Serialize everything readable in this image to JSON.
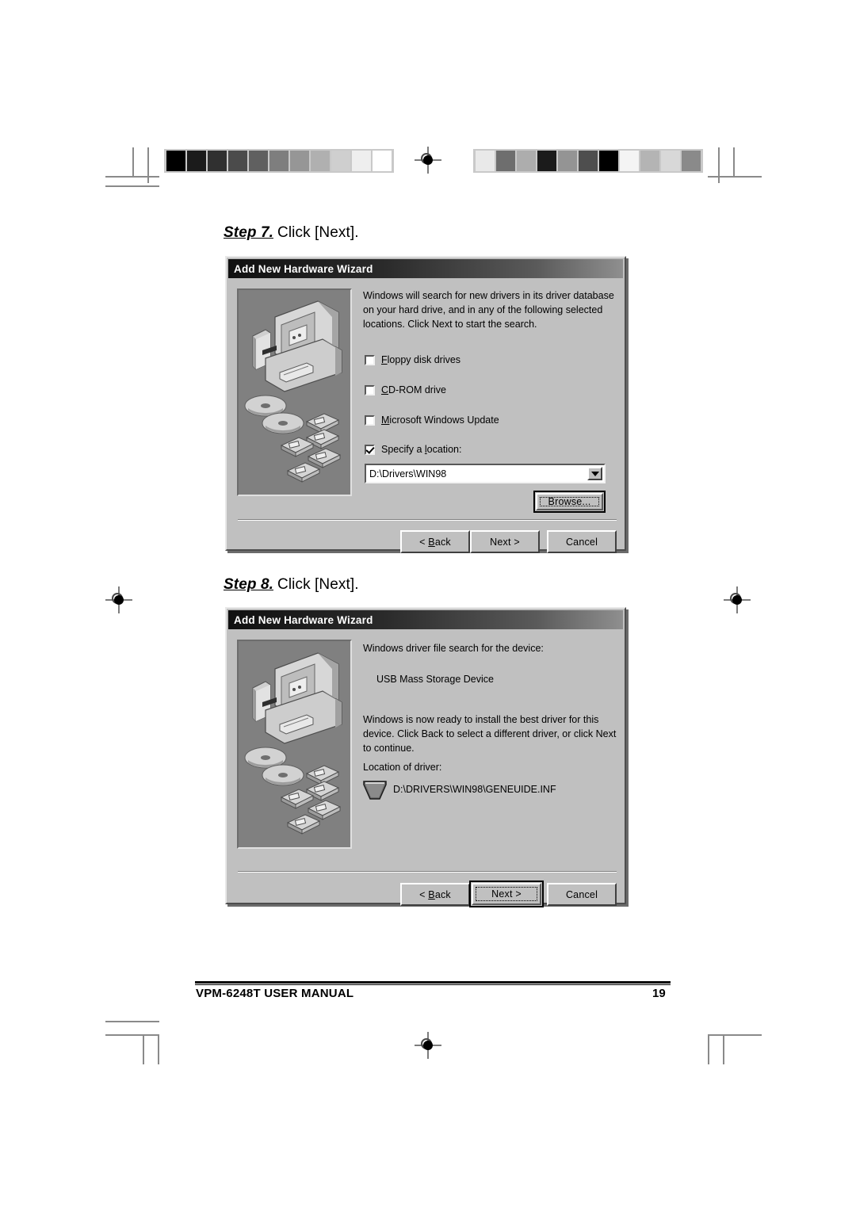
{
  "page": {
    "footer_title": "VPM-6248T USER MANUAL",
    "footer_page_number": "19"
  },
  "steps": [
    {
      "label": "Step 7.",
      "text": "Click [Next]."
    },
    {
      "label": "Step 8.",
      "text": "Click [Next]."
    }
  ],
  "dialog1": {
    "title": "Add New Hardware Wizard",
    "body_text": "Windows will search for new drivers in its driver database on your hard drive, and in any of the following selected locations. Click Next to start the search.",
    "checkboxes": [
      {
        "label": "Floppy disk drives",
        "accel": "F",
        "checked": false
      },
      {
        "label": "CD-ROM drive",
        "accel": "C",
        "checked": false
      },
      {
        "label": "Microsoft Windows Update",
        "accel": "M",
        "checked": false
      },
      {
        "label": "Specify a location:",
        "accel": "l",
        "checked": true
      }
    ],
    "location_value": "D:\\Drivers\\WIN98",
    "browse_label": "Browse...",
    "buttons": [
      {
        "label": "< Back",
        "default": false
      },
      {
        "label": "Next >",
        "default": false
      },
      {
        "label": "Cancel",
        "default": false
      }
    ]
  },
  "dialog2": {
    "title": "Add New Hardware Wizard",
    "heading_text": "Windows driver file search for the device:",
    "device_name": "USB Mass Storage Device",
    "body_text": "Windows is now ready to install the best driver for this device. Click Back to select a different driver, or click Next to continue.",
    "location_label": "Location of driver:",
    "driver_path": "D:\\DRIVERS\\WIN98\\GENEUIDE.INF",
    "buttons": [
      {
        "label": "< Back",
        "default": false
      },
      {
        "label": "Next >",
        "default": true
      },
      {
        "label": "Cancel",
        "default": false
      }
    ]
  },
  "print_marks": {
    "grayscale_bar_left": [
      "#000000",
      "#1b1b1b",
      "#303030",
      "#4b4b4b",
      "#606060",
      "#7e7e7e",
      "#969696",
      "#b0b0b0",
      "#cfcfcf",
      "#eeeeee",
      "#ffffff"
    ],
    "grayscale_bar_right": [
      "#e9e9e9",
      "#6e6e6e",
      "#adadad",
      "#1b1b1b",
      "#949494",
      "#4e4e4e",
      "#000000",
      "#f4f4f4",
      "#b4b4b4",
      "#d8d8d8",
      "#8a8a8a"
    ]
  }
}
